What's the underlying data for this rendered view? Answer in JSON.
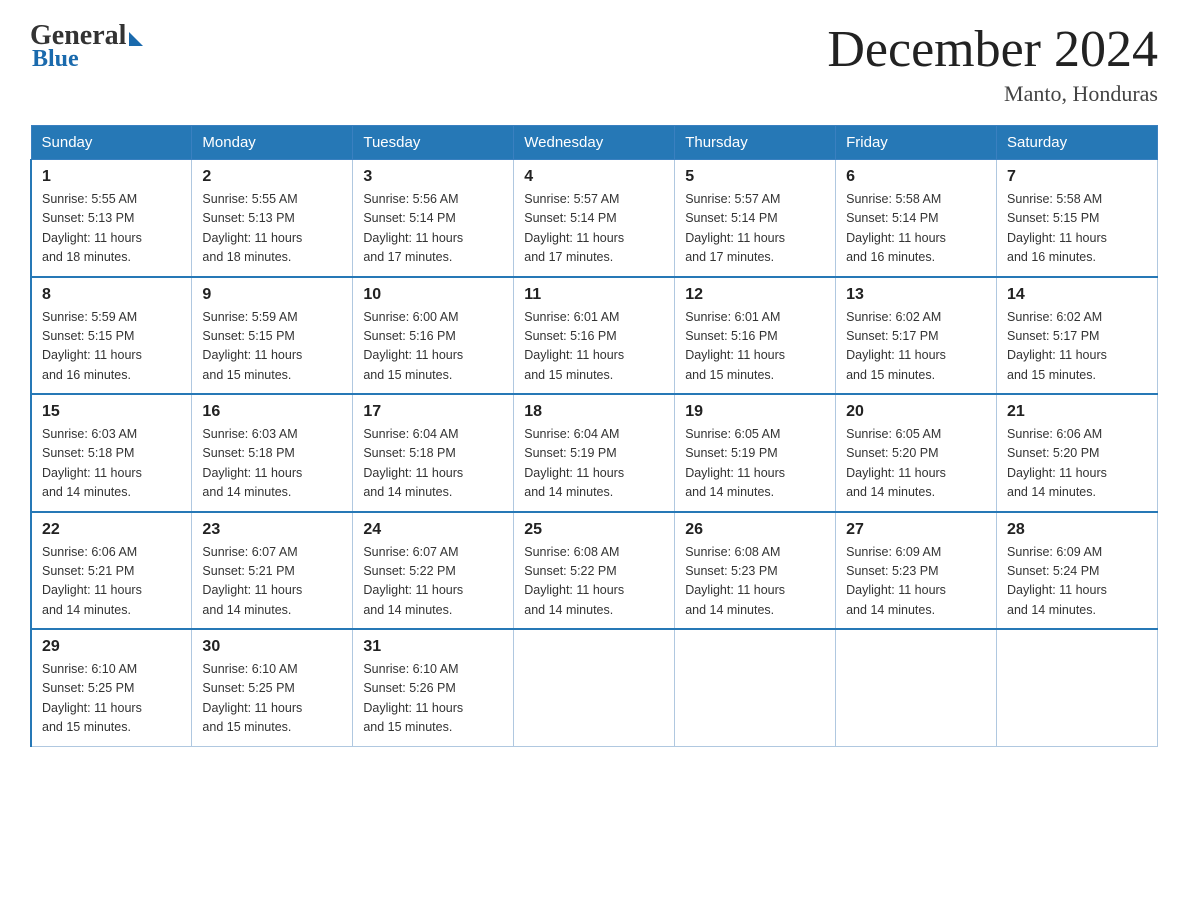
{
  "header": {
    "logo": {
      "general_text": "General",
      "blue_text": "Blue"
    },
    "title": "December 2024",
    "location": "Manto, Honduras"
  },
  "weekdays": [
    "Sunday",
    "Monday",
    "Tuesday",
    "Wednesday",
    "Thursday",
    "Friday",
    "Saturday"
  ],
  "weeks": [
    [
      {
        "day": "1",
        "sunrise": "5:55 AM",
        "sunset": "5:13 PM",
        "daylight": "11 hours and 18 minutes."
      },
      {
        "day": "2",
        "sunrise": "5:55 AM",
        "sunset": "5:13 PM",
        "daylight": "11 hours and 18 minutes."
      },
      {
        "day": "3",
        "sunrise": "5:56 AM",
        "sunset": "5:14 PM",
        "daylight": "11 hours and 17 minutes."
      },
      {
        "day": "4",
        "sunrise": "5:57 AM",
        "sunset": "5:14 PM",
        "daylight": "11 hours and 17 minutes."
      },
      {
        "day": "5",
        "sunrise": "5:57 AM",
        "sunset": "5:14 PM",
        "daylight": "11 hours and 17 minutes."
      },
      {
        "day": "6",
        "sunrise": "5:58 AM",
        "sunset": "5:14 PM",
        "daylight": "11 hours and 16 minutes."
      },
      {
        "day": "7",
        "sunrise": "5:58 AM",
        "sunset": "5:15 PM",
        "daylight": "11 hours and 16 minutes."
      }
    ],
    [
      {
        "day": "8",
        "sunrise": "5:59 AM",
        "sunset": "5:15 PM",
        "daylight": "11 hours and 16 minutes."
      },
      {
        "day": "9",
        "sunrise": "5:59 AM",
        "sunset": "5:15 PM",
        "daylight": "11 hours and 15 minutes."
      },
      {
        "day": "10",
        "sunrise": "6:00 AM",
        "sunset": "5:16 PM",
        "daylight": "11 hours and 15 minutes."
      },
      {
        "day": "11",
        "sunrise": "6:01 AM",
        "sunset": "5:16 PM",
        "daylight": "11 hours and 15 minutes."
      },
      {
        "day": "12",
        "sunrise": "6:01 AM",
        "sunset": "5:16 PM",
        "daylight": "11 hours and 15 minutes."
      },
      {
        "day": "13",
        "sunrise": "6:02 AM",
        "sunset": "5:17 PM",
        "daylight": "11 hours and 15 minutes."
      },
      {
        "day": "14",
        "sunrise": "6:02 AM",
        "sunset": "5:17 PM",
        "daylight": "11 hours and 15 minutes."
      }
    ],
    [
      {
        "day": "15",
        "sunrise": "6:03 AM",
        "sunset": "5:18 PM",
        "daylight": "11 hours and 14 minutes."
      },
      {
        "day": "16",
        "sunrise": "6:03 AM",
        "sunset": "5:18 PM",
        "daylight": "11 hours and 14 minutes."
      },
      {
        "day": "17",
        "sunrise": "6:04 AM",
        "sunset": "5:18 PM",
        "daylight": "11 hours and 14 minutes."
      },
      {
        "day": "18",
        "sunrise": "6:04 AM",
        "sunset": "5:19 PM",
        "daylight": "11 hours and 14 minutes."
      },
      {
        "day": "19",
        "sunrise": "6:05 AM",
        "sunset": "5:19 PM",
        "daylight": "11 hours and 14 minutes."
      },
      {
        "day": "20",
        "sunrise": "6:05 AM",
        "sunset": "5:20 PM",
        "daylight": "11 hours and 14 minutes."
      },
      {
        "day": "21",
        "sunrise": "6:06 AM",
        "sunset": "5:20 PM",
        "daylight": "11 hours and 14 minutes."
      }
    ],
    [
      {
        "day": "22",
        "sunrise": "6:06 AM",
        "sunset": "5:21 PM",
        "daylight": "11 hours and 14 minutes."
      },
      {
        "day": "23",
        "sunrise": "6:07 AM",
        "sunset": "5:21 PM",
        "daylight": "11 hours and 14 minutes."
      },
      {
        "day": "24",
        "sunrise": "6:07 AM",
        "sunset": "5:22 PM",
        "daylight": "11 hours and 14 minutes."
      },
      {
        "day": "25",
        "sunrise": "6:08 AM",
        "sunset": "5:22 PM",
        "daylight": "11 hours and 14 minutes."
      },
      {
        "day": "26",
        "sunrise": "6:08 AM",
        "sunset": "5:23 PM",
        "daylight": "11 hours and 14 minutes."
      },
      {
        "day": "27",
        "sunrise": "6:09 AM",
        "sunset": "5:23 PM",
        "daylight": "11 hours and 14 minutes."
      },
      {
        "day": "28",
        "sunrise": "6:09 AM",
        "sunset": "5:24 PM",
        "daylight": "11 hours and 14 minutes."
      }
    ],
    [
      {
        "day": "29",
        "sunrise": "6:10 AM",
        "sunset": "5:25 PM",
        "daylight": "11 hours and 15 minutes."
      },
      {
        "day": "30",
        "sunrise": "6:10 AM",
        "sunset": "5:25 PM",
        "daylight": "11 hours and 15 minutes."
      },
      {
        "day": "31",
        "sunrise": "6:10 AM",
        "sunset": "5:26 PM",
        "daylight": "11 hours and 15 minutes."
      },
      {
        "day": "",
        "sunrise": "",
        "sunset": "",
        "daylight": ""
      },
      {
        "day": "",
        "sunrise": "",
        "sunset": "",
        "daylight": ""
      },
      {
        "day": "",
        "sunrise": "",
        "sunset": "",
        "daylight": ""
      },
      {
        "day": "",
        "sunrise": "",
        "sunset": "",
        "daylight": ""
      }
    ]
  ],
  "labels": {
    "sunrise": "Sunrise:",
    "sunset": "Sunset:",
    "daylight": "Daylight:"
  }
}
